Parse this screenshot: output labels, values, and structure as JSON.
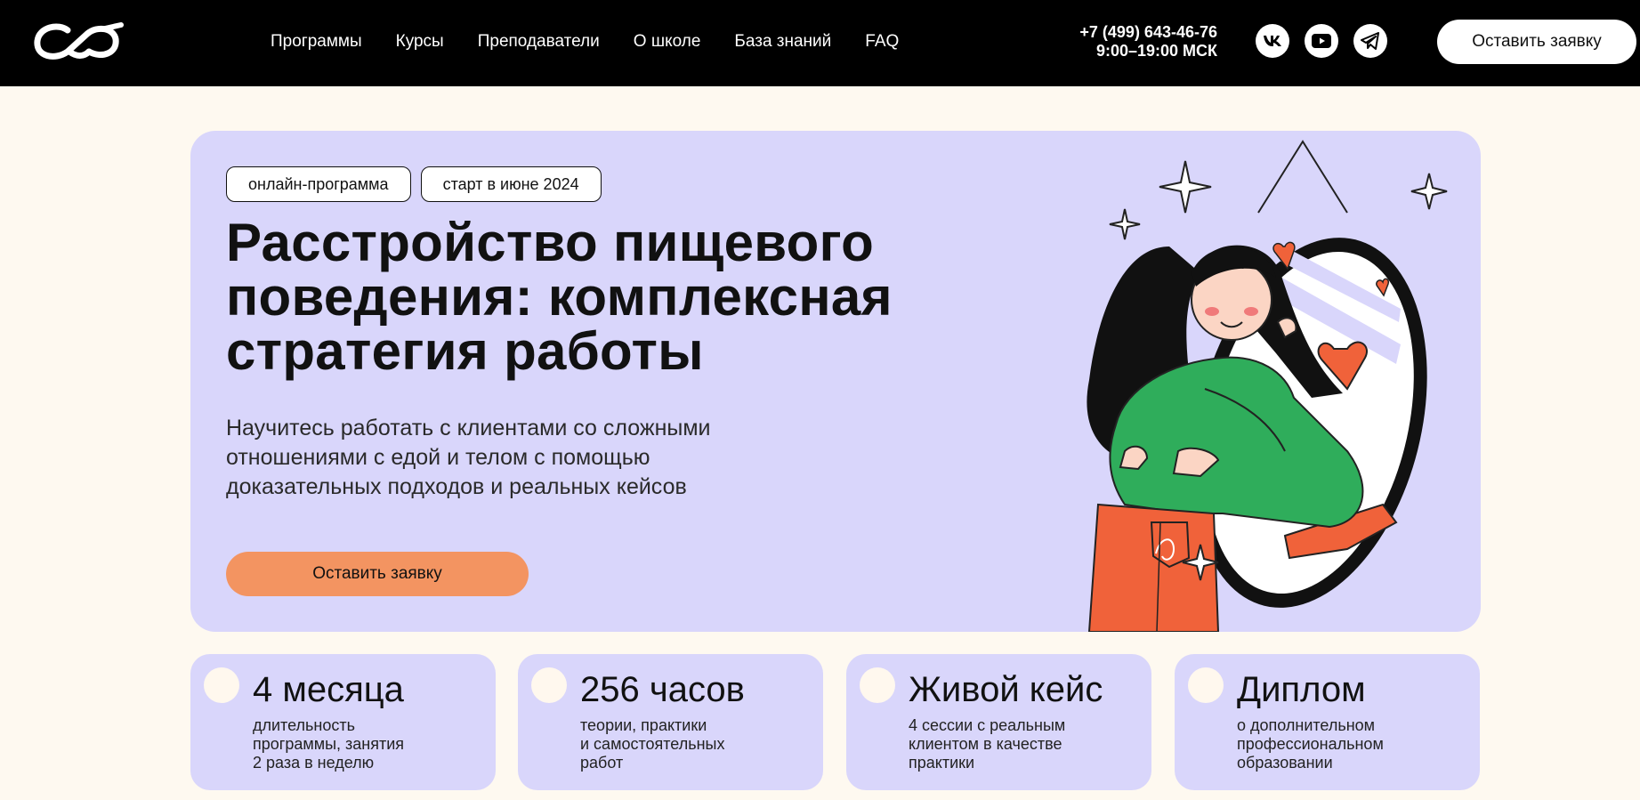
{
  "header": {
    "logo_icon": "infinity-logo-icon",
    "nav": [
      "Программы",
      "Курсы",
      "Преподаватели",
      "О школе",
      "База знаний",
      "FAQ"
    ],
    "phone": "+7 (499) 643-46-76",
    "hours": "9:00–19:00 МСК",
    "social": [
      "vk-icon",
      "youtube-icon",
      "telegram-icon"
    ],
    "cta_label": "Оставить заявку"
  },
  "hero": {
    "tags": [
      "онлайн-программа",
      "старт в июне 2024"
    ],
    "title": "Расстройство пищевого поведения: комплексная стратегия работы",
    "subtitle": "Научитесь работать с клиентами со сложными отношениями с едой и телом с помощью доказательных подходов и реальных кейсов",
    "cta_label": "Оставить заявку",
    "illustration": "girl-hugging-mirror-reflection-illustration"
  },
  "features": [
    {
      "title": "4 месяца",
      "desc": "длительность\nпрограммы, занятия\n2 раза в неделю"
    },
    {
      "title": "256 часов",
      "desc": "теории, практики\nи самостоятельных\nработ"
    },
    {
      "title": "Живой кейс",
      "desc": "4 сессии с реальным\nклиентом в качестве\nпрактики"
    },
    {
      "title": "Диплом",
      "desc": "о дополнительном\nпрофессиональном\nобразовании"
    }
  ],
  "colors": {
    "header_bg": "#000000",
    "page_bg": "#fef9f0",
    "hero_bg": "#d9d6fb",
    "accent": "#f39461",
    "sweater": "#2fad5b",
    "pants": "#f0623a"
  }
}
